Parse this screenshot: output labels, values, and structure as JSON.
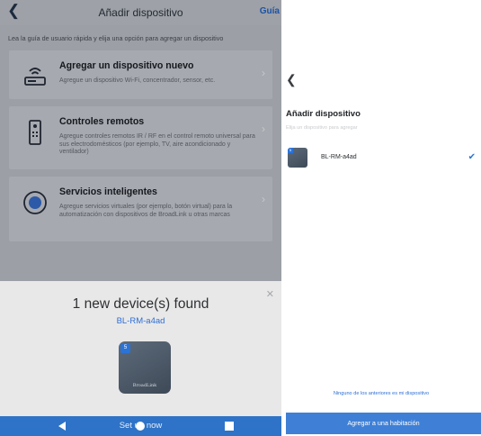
{
  "left": {
    "header": {
      "back_icon": "chevron-left-icon",
      "title": "Añadir dispositivo",
      "guide_link": "Guía"
    },
    "hint": "Lea la guía de usuario rápida y elija una opción para agregar un dispositivo",
    "options": [
      {
        "icon": "router-icon",
        "title": "Agregar un dispositivo nuevo",
        "description": "Agregue un dispositivo Wi-Fi, concentrador, sensor, etc."
      },
      {
        "icon": "remote-control-icon",
        "title": "Controles remotos",
        "description": "Agregue controles remotos IR / RF en el control remoto universal para sus electrodomésticos (por ejemplo, TV, aire acondicionado y ventilador)"
      },
      {
        "icon": "smart-service-icon",
        "title": "Servicios inteligentes",
        "description": "Agregue servicios virtuales (por ejemplo, botón virtual) para la automatización con dispositivos de BroadLink u otras marcas"
      }
    ],
    "found_panel": {
      "close_icon": "close-icon",
      "title": "1 new device(s) found",
      "device_name": "BL-RM-a4ad",
      "badge": "5",
      "brand": "BroadLink"
    },
    "bottom_bar": {
      "button_text": "Set up now",
      "nav": [
        "back-triangle-icon",
        "home-circle-icon",
        "recent-square-icon"
      ]
    }
  },
  "right": {
    "back_icon": "chevron-left-icon",
    "title": "Añadir dispositivo",
    "subtitle": "Elija un dispositivo para agregar",
    "device": {
      "name": "BL-RM-a4ad",
      "badge": "5",
      "selected": true
    },
    "none_link": "Ninguno de los anteriores es mi dispositivo",
    "add_button": "Agregar a una habitación"
  },
  "colors": {
    "accent": "#2f6fd6",
    "button_blue": "#3f80d6",
    "overlay_gray": "#9c9fa6"
  }
}
